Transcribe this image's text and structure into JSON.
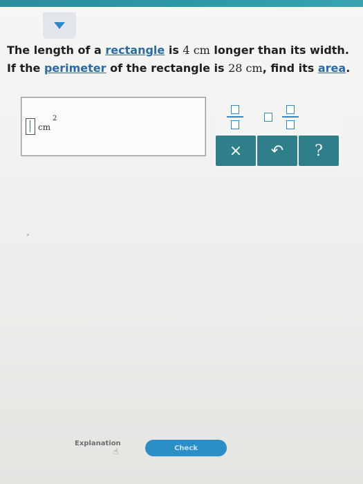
{
  "question": {
    "line1": {
      "pre": "The length of a ",
      "link": "rectangle",
      "mid": " is ",
      "math": "4 cm",
      "post": " longer than its width."
    },
    "line2": {
      "pre": "If the ",
      "link1": "perimeter",
      "mid": " of the rectangle is ",
      "math": "28 cm",
      "mid2": ", find its ",
      "link2": "area",
      "post": "."
    }
  },
  "answer": {
    "unit": "cm",
    "exponent": "2"
  },
  "keypad": {
    "clear_label": "×",
    "undo_label": "↶",
    "help_label": "?"
  },
  "footer": {
    "explanation_label": "Explanation",
    "check_label": "Check"
  },
  "colors": {
    "topbar": "#2f9aa8",
    "keypad_button": "#2f7f8a",
    "link": "#2a6aa8",
    "check": "#2a8ec7"
  },
  "icons": [
    "chevron-down-icon",
    "fraction-icon",
    "mixed-number-icon",
    "undo-icon",
    "hand-pointer-icon"
  ]
}
